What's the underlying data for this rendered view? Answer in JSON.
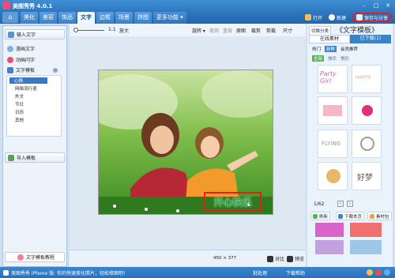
{
  "app": {
    "title": "美图秀秀 4.0.1"
  },
  "nav": {
    "home_icon": "home-icon",
    "tabs": [
      {
        "label": "美化"
      },
      {
        "label": "美容"
      },
      {
        "label": "饰品"
      },
      {
        "label": "文字"
      },
      {
        "label": "边框"
      },
      {
        "label": "场景"
      },
      {
        "label": "拼图"
      },
      {
        "label": "更多功能 ▾"
      }
    ],
    "open_label": "打开",
    "new_label": "新建",
    "save_label": "保存与分享"
  },
  "toolbar": {
    "zoom_value": "1:1",
    "enlarge": "放大",
    "rotate": "旋转 ▾",
    "undo": "撤销",
    "redo": "重做",
    "original": "原图",
    "crop": "裁剪",
    "size": "尺寸",
    "trim": "剪裁"
  },
  "sidebar": {
    "input_text": "输入文字",
    "comic_text": "漫画文字",
    "animated_flash": "动画闪字",
    "template_header": "文字模板",
    "tree_items": [
      "心情",
      "网络流行语",
      "外文",
      "节日",
      "日历",
      "其他"
    ],
    "import_template": "导入模板",
    "tutorial": "文字模板教程"
  },
  "canvas": {
    "overlay_text": "开心快乐",
    "size_readout": "450 × 377",
    "compare": "对比",
    "prev": "预览"
  },
  "rightpanel": {
    "switch_category": "切换分类",
    "big_title": "《文字模板》",
    "tab_online": "在线素材",
    "tab_downloaded": "已下载(1)",
    "subtabs": [
      "热门",
      "新鲜",
      "会员推荐"
    ],
    "filters": [
      "全部",
      "快乐",
      "悦乐"
    ],
    "page": "1/62",
    "refresh": "刷新",
    "download": "下载本页",
    "material_pack": "素材包"
  },
  "status": {
    "message": "美图秀秀 iPhone 版: 你的快速美化照片，轻松修图吧!",
    "batch": "批处理",
    "help": "下载帮助"
  },
  "colors": {
    "accent_blue": "#2f79c2",
    "tab_active": "#f4f8fd",
    "highlight_red": "#e02020",
    "text_green": "#2ca24a"
  }
}
